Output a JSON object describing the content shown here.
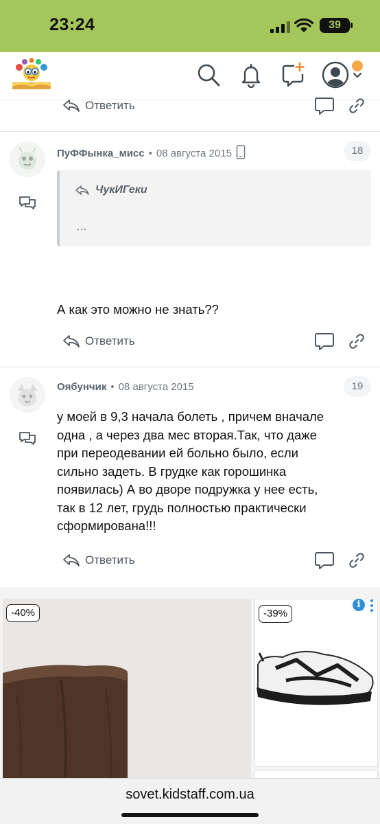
{
  "status_bar": {
    "time": "23:24",
    "battery": "39",
    "icons": [
      "signal-icon",
      "wifi-icon",
      "battery-icon"
    ]
  },
  "header": {
    "icons": [
      "site-logo",
      "search-icon",
      "bell-icon",
      "new-post-icon",
      "user-avatar-icon",
      "chevron-down-icon"
    ],
    "accent_color": "#a5c65a",
    "notification_dot_color": "#f6a94a"
  },
  "top_actions": {
    "reply_label": "Ответить"
  },
  "comments": [
    {
      "author": "ПуФФынка_мисс",
      "date": "08 августа 2015",
      "number": "18",
      "device": "mobile-icon",
      "quote": {
        "author": "ЧукИГеки",
        "text": "…"
      },
      "text": "А как это можно не знать??",
      "reply_label": "Ответить"
    },
    {
      "author": "Оябунчик",
      "date": "08 августа 2015",
      "number": "19",
      "text_lines": [
        "у моей в 9,3 начала болеть , причем вначале",
        "одна , а через два мес вторая.Так, что даже",
        "при переодевании ей больно было, если",
        "сильно задеть. В грудке как горошинка",
        "появилась) А во дворе подружка у нее есть,",
        "так в 12 лет, грудь полностью практически",
        "сформирована!!!"
      ],
      "reply_label": "Ответить"
    }
  ],
  "ad": {
    "items": [
      {
        "discount": "-40%",
        "product": "boot"
      },
      {
        "discount": "-39%",
        "product": "sneaker"
      }
    ],
    "info_label": "i"
  },
  "browser": {
    "url": "sovet.kidstaff.com.ua"
  }
}
